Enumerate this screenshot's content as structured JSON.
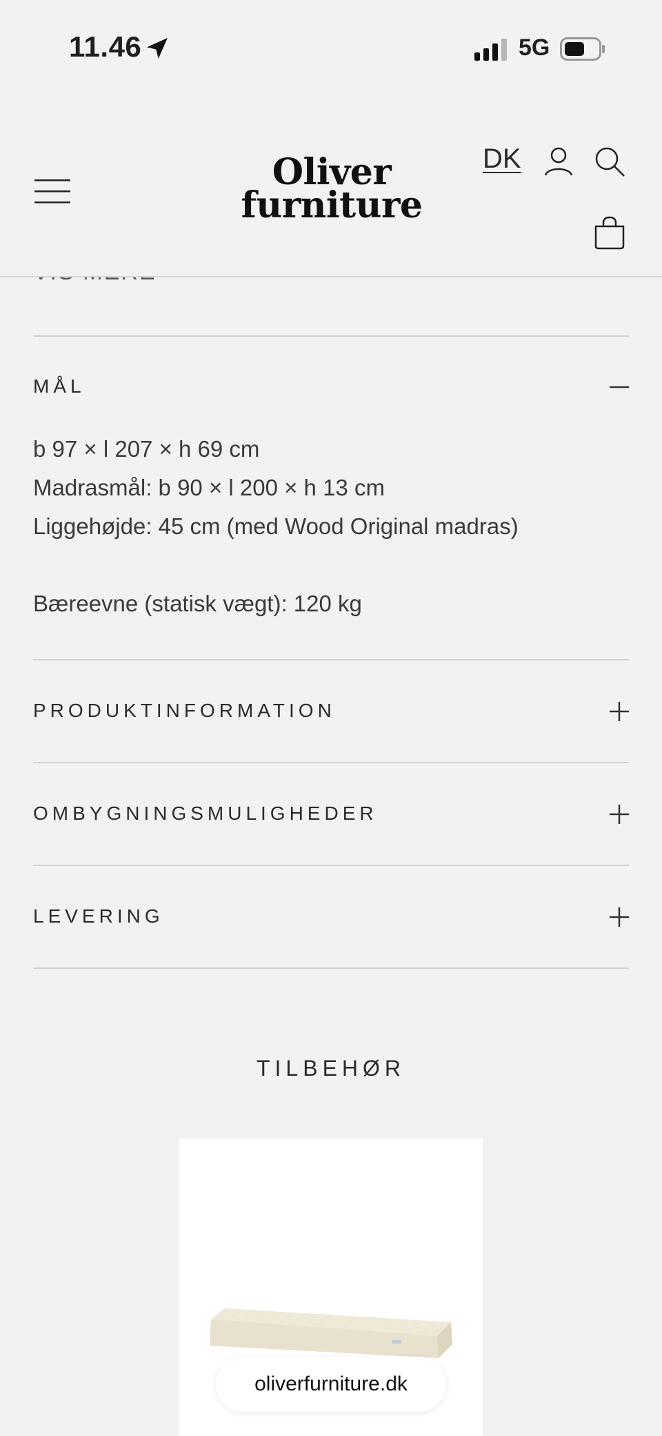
{
  "status": {
    "time": "11.46",
    "network": "5G"
  },
  "header": {
    "logo_line1": "Oliver",
    "logo_line2": "furniture",
    "language": "DK"
  },
  "partial_text": "VIS MERE",
  "sections": {
    "maal": {
      "title": "MÅL",
      "lines": [
        "b 97 × l 207 × h 69 cm",
        "Madrasmål: b 90 × l 200 × h 13 cm",
        "Liggehøjde: 45 cm (med Wood Original madras)",
        "Bæreevne (statisk vægt): 120 kg"
      ]
    },
    "produktinformation": {
      "title": "PRODUKTINFORMATION"
    },
    "ombygning": {
      "title": "OMBYGNINGSMULIGHEDER"
    },
    "levering": {
      "title": "LEVERING"
    }
  },
  "accessories": {
    "heading": "TILBEHØR"
  },
  "browser": {
    "url": "oliverfurniture.dk"
  },
  "colors": {
    "background": "#f2f2f1",
    "text": "#1f1f1f",
    "divider": "#d2d2d2"
  }
}
